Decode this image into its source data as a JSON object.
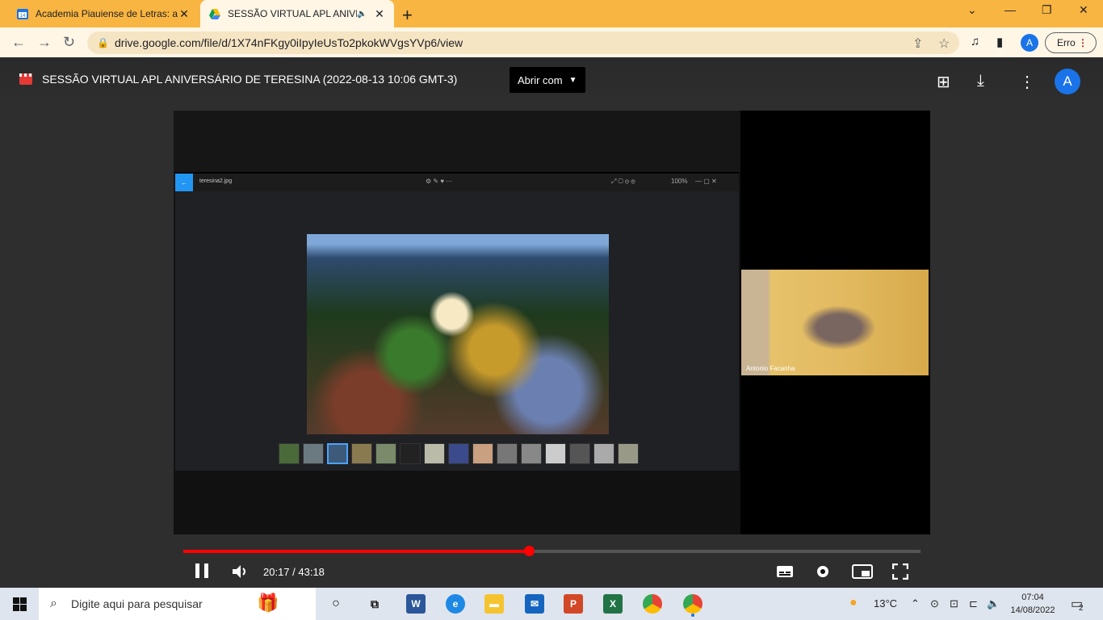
{
  "browser": {
    "tabs": [
      {
        "title": "Academia Piauiense de Letras: ag",
        "favicon": "calendar-14-icon",
        "close": "✕"
      },
      {
        "title": "SESSÃO VIRTUAL APL ANIVE",
        "favicon": "google-drive-icon",
        "close": "✕",
        "active": true,
        "audio": "🔈"
      }
    ],
    "new_tab": "+",
    "window_controls": {
      "minimize": "—",
      "restore": "❐",
      "close": "✕",
      "dropdown": "⌄"
    },
    "url": "drive.google.com/file/d/1X74nFKgy0iIpyIeUsTo2pkokWVgsYVp6/view",
    "profile_initial": "A",
    "error_label": "Erro",
    "accent": "#f9b541"
  },
  "drive": {
    "file_title": "SESSÃO VIRTUAL APL ANIVERSÁRIO DE TERESINA (2022-08-13 10:06 GMT-3)",
    "open_with": "Abrir com",
    "avatar_initial": "A"
  },
  "video": {
    "viewer_filename": "teresina2.jpg",
    "zoom_label": "100%",
    "participant_name": "Antonio Facanha",
    "current_time": "20:17",
    "duration": "43:18",
    "time_display": "20:17 / 43:18",
    "progress_fraction": 0.469,
    "progress_color": "#ff0000"
  },
  "taskbar": {
    "search_placeholder": "Digite aqui para pesquisar",
    "weather": "13°C",
    "time": "07:04",
    "date": "14/08/2022",
    "notifications": "2"
  }
}
